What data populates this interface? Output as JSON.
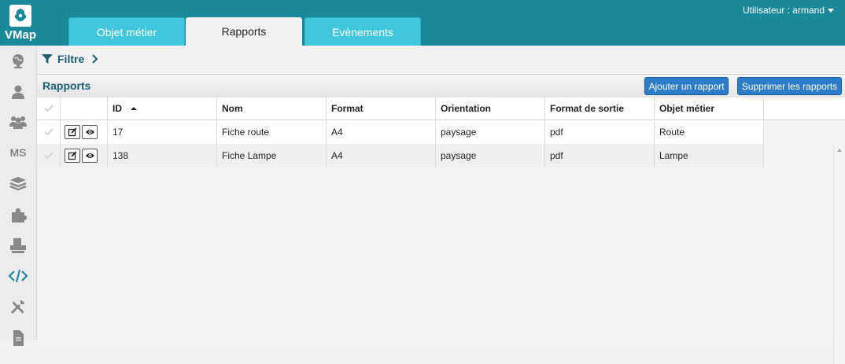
{
  "app": {
    "logo_text": "VMap",
    "user": "Utilisateur : armand"
  },
  "tabs": [
    {
      "label": "Objet métier",
      "active": false
    },
    {
      "label": "Rapports",
      "active": true
    },
    {
      "label": "Evènements",
      "active": false
    }
  ],
  "sidebar": {
    "items": [
      {
        "icon": "globe-icon"
      },
      {
        "icon": "user-icon"
      },
      {
        "icon": "users-icon"
      },
      {
        "icon": "ms-icon",
        "label": "MS"
      },
      {
        "icon": "layers-icon"
      },
      {
        "icon": "puzzle-icon"
      },
      {
        "icon": "printer-icon"
      },
      {
        "icon": "code-icon",
        "active": true
      },
      {
        "icon": "tools-icon"
      },
      {
        "icon": "file-icon"
      }
    ]
  },
  "filter": {
    "label": "Filtre"
  },
  "panel": {
    "title": "Rapports",
    "add_button": "Ajouter un rapport",
    "delete_button": "Supprimer les rapports"
  },
  "table": {
    "columns": [
      "ID",
      "Nom",
      "Format",
      "Orientation",
      "Format de sortie",
      "Objet métier"
    ],
    "sort": {
      "column": "ID",
      "direction": "asc"
    },
    "rows": [
      {
        "id": "17",
        "nom": "Fiche route",
        "format": "A4",
        "orientation": "paysage",
        "sortie": "pdf",
        "objet": "Route"
      },
      {
        "id": "138",
        "nom": "Fiche Lampe",
        "format": "A4",
        "orientation": "paysage",
        "sortie": "pdf",
        "objet": "Lampe"
      }
    ]
  },
  "colors": {
    "topbar": "#1a8a9b",
    "tab_inactive": "#41c7dd",
    "accent": "#1d5f73",
    "button": "#2d7cc7"
  }
}
